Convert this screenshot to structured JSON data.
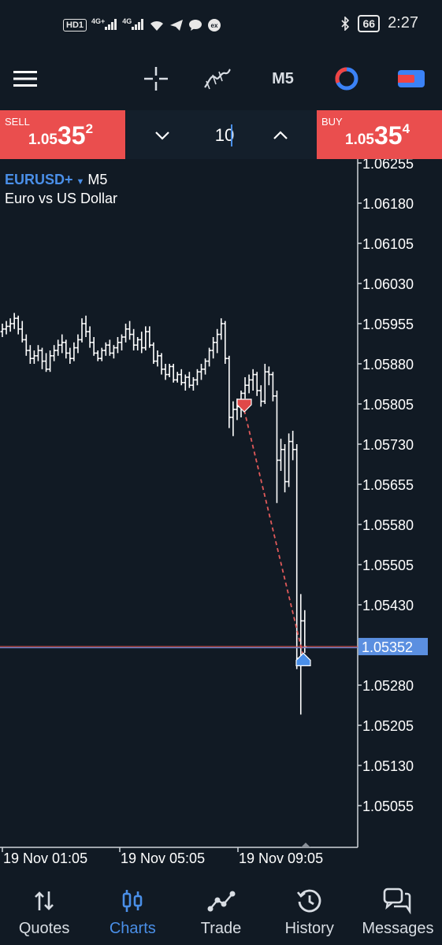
{
  "status_bar": {
    "left_indicators": [
      "HD1",
      "4G+",
      "4G"
    ],
    "battery": "66",
    "time": "2:27"
  },
  "toolbar": {
    "timeframe": "M5"
  },
  "trade": {
    "sell": {
      "label": "SELL",
      "price_small": "1.05",
      "price_big": "35",
      "price_sup": "2"
    },
    "buy": {
      "label": "BUY",
      "price_small": "1.05",
      "price_big": "35",
      "price_sup": "4"
    },
    "volume": "10"
  },
  "chart_header": {
    "symbol": "EURUSD+",
    "timeframe": "M5",
    "description": "Euro vs US Dollar"
  },
  "chart_data": {
    "type": "ohlc",
    "symbol": "EURUSD+",
    "timeframe": "M5",
    "price_axis": [
      "1.06255",
      "1.06180",
      "1.06105",
      "1.06030",
      "1.05955",
      "1.05880",
      "1.05805",
      "1.05730",
      "1.05655",
      "1.05580",
      "1.05505",
      "1.05430",
      "1.05352",
      "1.05280",
      "1.05205",
      "1.05130",
      "1.05055"
    ],
    "time_axis": [
      "19 Nov 01:05",
      "19 Nov 05:05",
      "19 Nov 09:05"
    ],
    "current_price": "1.05352",
    "ylim": [
      1.05,
      1.063
    ],
    "bars": [
      [
        1.0594,
        1.05955,
        1.0593,
        1.05945
      ],
      [
        1.05945,
        1.0596,
        1.05935,
        1.0595
      ],
      [
        1.0595,
        1.05965,
        1.0594,
        1.05955
      ],
      [
        1.05955,
        1.05975,
        1.05945,
        1.05965
      ],
      [
        1.05965,
        1.0597,
        1.05935,
        1.05945
      ],
      [
        1.05945,
        1.0596,
        1.0592,
        1.05925
      ],
      [
        1.05925,
        1.05935,
        1.05895,
        1.05905
      ],
      [
        1.05905,
        1.05915,
        1.0588,
        1.0589
      ],
      [
        1.0589,
        1.05905,
        1.0588,
        1.05895
      ],
      [
        1.05895,
        1.05915,
        1.05885,
        1.05905
      ],
      [
        1.05905,
        1.0591,
        1.0587,
        1.05885
      ],
      [
        1.05885,
        1.059,
        1.05865,
        1.0587
      ],
      [
        1.0587,
        1.05905,
        1.05865,
        1.05895
      ],
      [
        1.05895,
        1.05915,
        1.05885,
        1.05905
      ],
      [
        1.05905,
        1.05925,
        1.05895,
        1.05915
      ],
      [
        1.05915,
        1.05935,
        1.059,
        1.0592
      ],
      [
        1.0592,
        1.05925,
        1.0589,
        1.059
      ],
      [
        1.059,
        1.0591,
        1.0588,
        1.0589
      ],
      [
        1.0589,
        1.0592,
        1.05885,
        1.0591
      ],
      [
        1.0591,
        1.05935,
        1.059,
        1.05925
      ],
      [
        1.05925,
        1.05965,
        1.0592,
        1.05955
      ],
      [
        1.05955,
        1.0597,
        1.0593,
        1.0594
      ],
      [
        1.0594,
        1.0595,
        1.0591,
        1.0592
      ],
      [
        1.0592,
        1.0593,
        1.05895,
        1.059
      ],
      [
        1.059,
        1.05905,
        1.05885,
        1.0589
      ],
      [
        1.0589,
        1.0591,
        1.05885,
        1.05905
      ],
      [
        1.05905,
        1.0592,
        1.05895,
        1.05915
      ],
      [
        1.05915,
        1.05925,
        1.05895,
        1.059
      ],
      [
        1.059,
        1.05915,
        1.0589,
        1.0591
      ],
      [
        1.0591,
        1.0593,
        1.059,
        1.0592
      ],
      [
        1.0592,
        1.05935,
        1.05905,
        1.0593
      ],
      [
        1.0593,
        1.05955,
        1.0592,
        1.05945
      ],
      [
        1.05945,
        1.0596,
        1.05925,
        1.05935
      ],
      [
        1.05935,
        1.05945,
        1.05905,
        1.05915
      ],
      [
        1.05915,
        1.0593,
        1.05905,
        1.05925
      ],
      [
        1.05925,
        1.0594,
        1.059,
        1.0591
      ],
      [
        1.0591,
        1.0595,
        1.05905,
        1.0594
      ],
      [
        1.0594,
        1.0595,
        1.0591,
        1.05915
      ],
      [
        1.05915,
        1.0592,
        1.0588,
        1.05885
      ],
      [
        1.05885,
        1.05905,
        1.05875,
        1.05895
      ],
      [
        1.05895,
        1.059,
        1.0586,
        1.0587
      ],
      [
        1.0587,
        1.0588,
        1.0585,
        1.0586
      ],
      [
        1.0586,
        1.0588,
        1.05855,
        1.05875
      ],
      [
        1.05875,
        1.0588,
        1.05845,
        1.0585
      ],
      [
        1.0585,
        1.05865,
        1.05845,
        1.0586
      ],
      [
        1.0586,
        1.0587,
        1.0584,
        1.05845
      ],
      [
        1.05845,
        1.0586,
        1.0583,
        1.05855
      ],
      [
        1.05855,
        1.05865,
        1.05835,
        1.0584
      ],
      [
        1.0584,
        1.05855,
        1.0583,
        1.0585
      ],
      [
        1.0585,
        1.0587,
        1.0584,
        1.05865
      ],
      [
        1.05865,
        1.0588,
        1.0585,
        1.0587
      ],
      [
        1.0587,
        1.0589,
        1.0586,
        1.05885
      ],
      [
        1.05885,
        1.0591,
        1.05875,
        1.05905
      ],
      [
        1.05905,
        1.0593,
        1.0589,
        1.0592
      ],
      [
        1.0592,
        1.05945,
        1.059,
        1.05935
      ],
      [
        1.05935,
        1.05965,
        1.05925,
        1.05955
      ],
      [
        1.05955,
        1.0596,
        1.0588,
        1.0589
      ],
      [
        1.0589,
        1.05895,
        1.0576,
        1.0578
      ],
      [
        1.0578,
        1.0581,
        1.05745,
        1.05795
      ],
      [
        1.05795,
        1.05815,
        1.05775,
        1.058
      ],
      [
        1.058,
        1.0583,
        1.0578,
        1.05825
      ],
      [
        1.05825,
        1.05855,
        1.05815,
        1.0584
      ],
      [
        1.0584,
        1.0586,
        1.05825,
        1.0585
      ],
      [
        1.0585,
        1.0587,
        1.0583,
        1.0586
      ],
      [
        1.0586,
        1.05865,
        1.0582,
        1.0583
      ],
      [
        1.0583,
        1.0584,
        1.058,
        1.0581
      ],
      [
        1.0581,
        1.0588,
        1.05805,
        1.05865
      ],
      [
        1.05865,
        1.05875,
        1.0584,
        1.0586
      ],
      [
        1.0586,
        1.05865,
        1.0581,
        1.0582
      ],
      [
        1.0582,
        1.0583,
        1.0562,
        1.057
      ],
      [
        1.057,
        1.0574,
        1.0568,
        1.0572
      ],
      [
        1.0572,
        1.0573,
        1.0564,
        1.0566
      ],
      [
        1.0566,
        1.0575,
        1.0565,
        1.05735
      ],
      [
        1.05735,
        1.05755,
        1.057,
        1.0572
      ],
      [
        1.0572,
        1.0573,
        1.0531,
        1.0533
      ],
      [
        1.0533,
        1.0545,
        1.05225,
        1.054
      ],
      [
        1.054,
        1.0542,
        1.0534,
        1.05352
      ]
    ],
    "sell_marker_price": 1.05805,
    "buy_marker_price": 1.05325
  },
  "nav": {
    "items": [
      {
        "label": "Quotes"
      },
      {
        "label": "Charts"
      },
      {
        "label": "Trade"
      },
      {
        "label": "History"
      },
      {
        "label": "Messages"
      }
    ]
  }
}
